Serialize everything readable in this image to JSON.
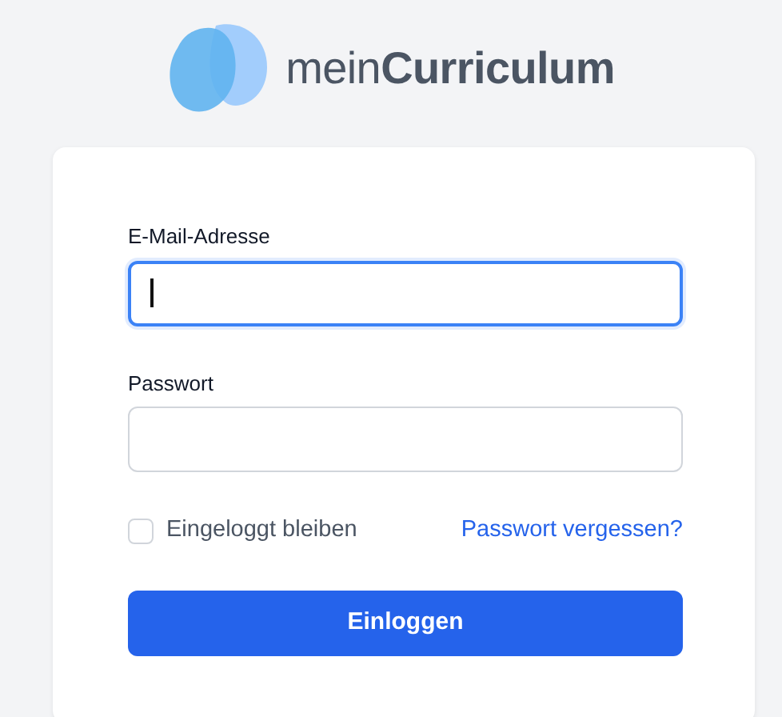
{
  "logo": {
    "text": "mein**Curriculum**"
  },
  "fields": [
    {
      "label": "E-Mail-Adresse",
      "focused": true
    },
    {
      "label": "Passwort",
      "focused": false
    }
  ],
  "remember": {
    "label": "Eingeloggt bleiben",
    "checked": false
  },
  "forgot_link": "Passwort vergessen?",
  "submit_button": "Einloggen"
}
